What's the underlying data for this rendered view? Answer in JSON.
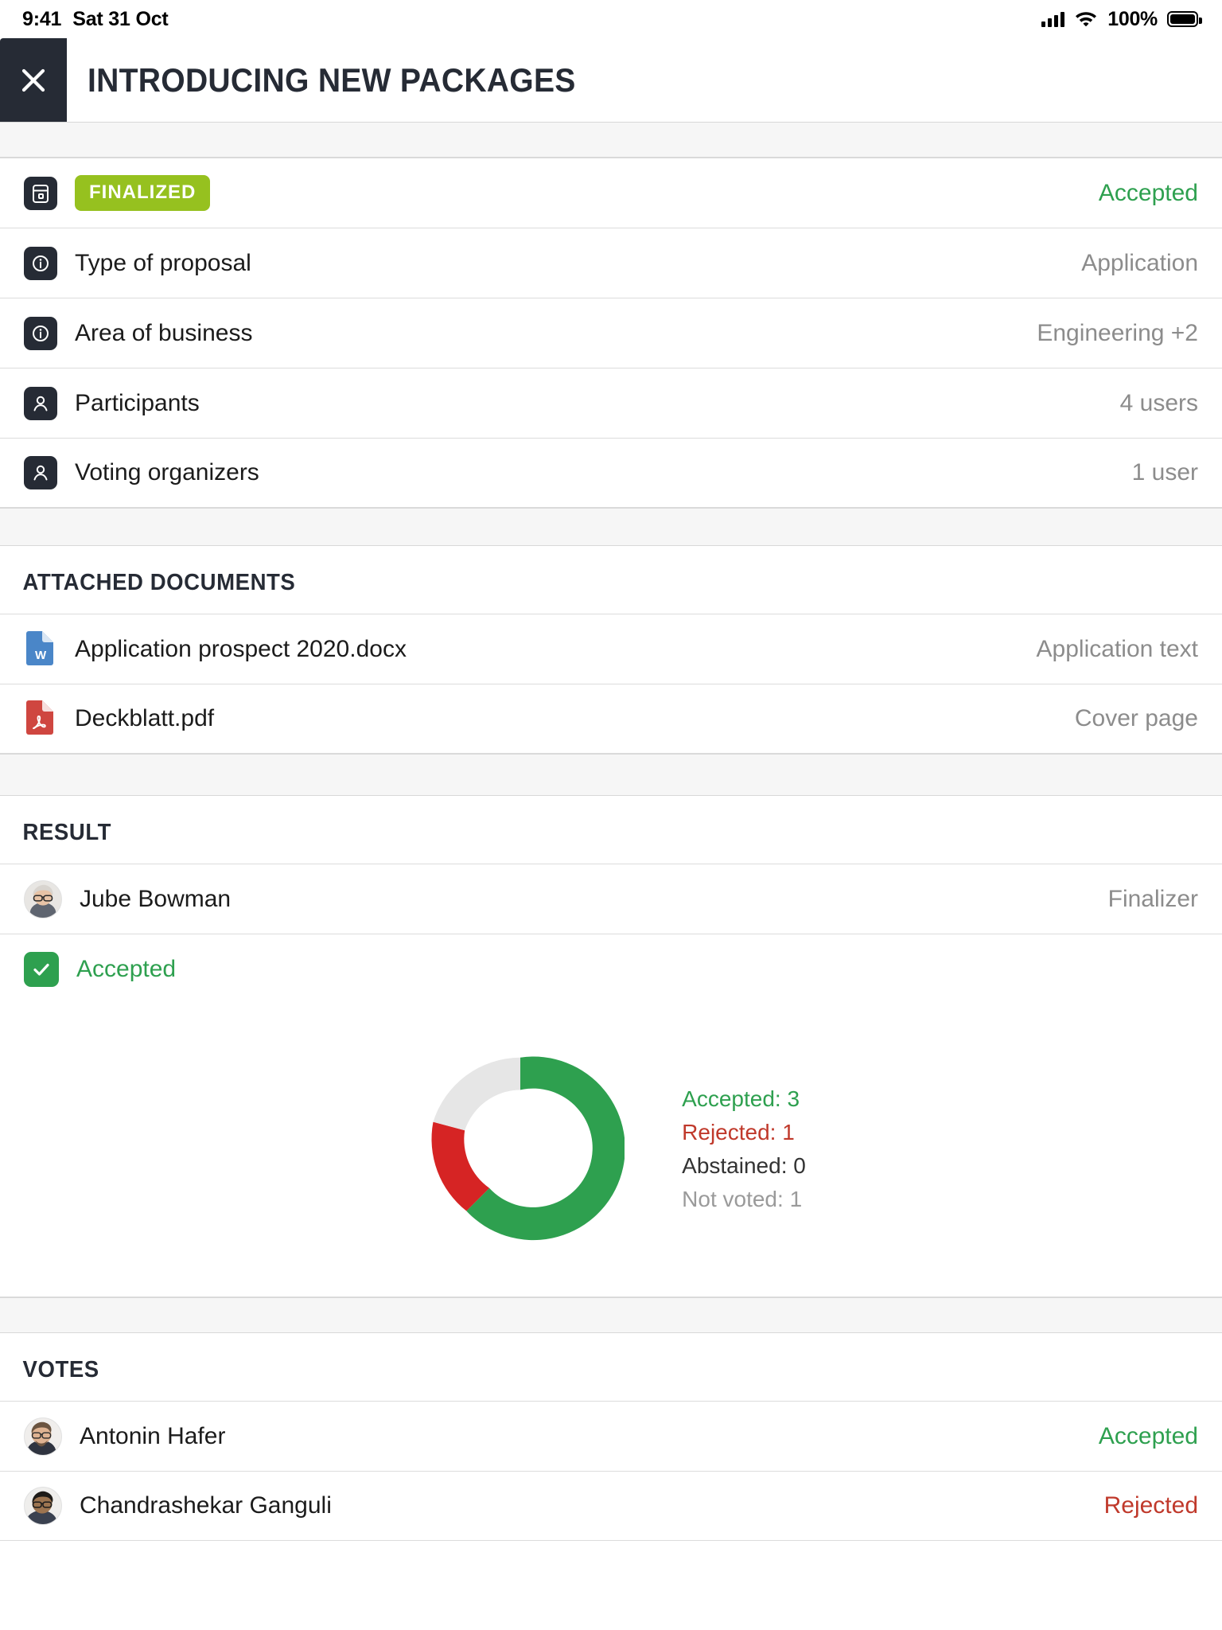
{
  "statusbar": {
    "time": "9:41",
    "date": "Sat 31 Oct",
    "battery_pct": "100%",
    "cellular_icon": "cellular-bars-icon",
    "wifi_icon": "wifi-icon",
    "battery_icon": "battery-full-icon"
  },
  "header": {
    "close_icon": "close-icon",
    "title": "INTRODUCING NEW PACKAGES"
  },
  "info": {
    "rows": [
      {
        "icon": "calendar-icon",
        "badge": "FINALIZED",
        "label": "",
        "value": "Accepted",
        "value_style": "green"
      },
      {
        "icon": "info-icon",
        "badge": "",
        "label": "Type of proposal",
        "value": "Application",
        "value_style": "muted"
      },
      {
        "icon": "info-icon",
        "badge": "",
        "label": "Area of business",
        "value": "Engineering +2",
        "value_style": "muted"
      },
      {
        "icon": "user-icon",
        "badge": "",
        "label": "Participants",
        "value": "4 users",
        "value_style": "muted"
      },
      {
        "icon": "user-icon",
        "badge": "",
        "label": "Voting organizers",
        "value": "1 user",
        "value_style": "muted"
      }
    ]
  },
  "documents": {
    "title": "ATTACHED DOCUMENTS",
    "items": [
      {
        "icon": "word-file-icon",
        "name": "Application prospect 2020.docx",
        "kind": "Application text"
      },
      {
        "icon": "pdf-file-icon",
        "name": "Deckblatt.pdf",
        "kind": "Cover page"
      }
    ]
  },
  "result": {
    "title": "RESULT",
    "finalizer": {
      "avatar": "avatar-jube-bowman",
      "name": "Jube Bowman",
      "role": "Finalizer"
    },
    "decision": {
      "icon": "check-icon",
      "label": "Accepted"
    }
  },
  "chart_data": {
    "type": "pie",
    "title": "",
    "subtype": "donut",
    "categories": [
      "Accepted",
      "Rejected",
      "Abstained",
      "Not voted"
    ],
    "values": [
      3,
      1,
      0,
      1
    ],
    "colors": [
      "#2eA04f",
      "#d62424",
      "#333333",
      "#e6e6e6"
    ],
    "legend_position": "right",
    "legend_labels": [
      "Accepted: 3",
      "Rejected: 1",
      "Abstained: 0",
      "Not voted: 1"
    ],
    "total": 5,
    "inner_radius_ratio": 0.62
  },
  "votes": {
    "title": "VOTES",
    "items": [
      {
        "avatar": "avatar-antonin-hafer",
        "name": "Antonin Hafer",
        "vote": "Accepted",
        "vote_style": "green"
      },
      {
        "avatar": "avatar-chandrashekar-ganguli",
        "name": "Chandrashekar Ganguli",
        "vote": "Rejected",
        "vote_style": "red"
      }
    ]
  },
  "colors": {
    "accent_green": "#2eA04f",
    "badge_green": "#96c11f",
    "danger_red": "#c0392b",
    "chart_red": "#d62424",
    "dark": "#262b35",
    "muted": "#8c8c8c"
  }
}
